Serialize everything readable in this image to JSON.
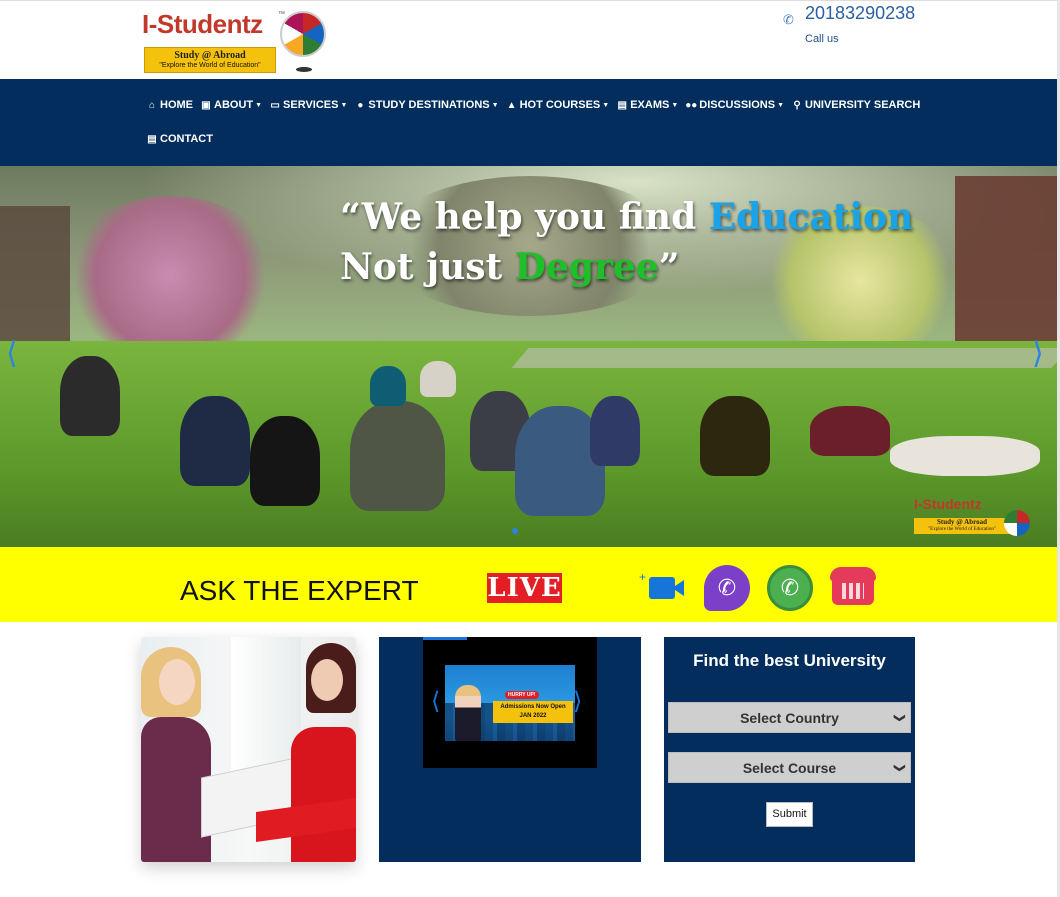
{
  "header": {
    "logo": {
      "brand": "I-Studentz",
      "trademark": "™",
      "tagline1": "Study @ Abroad",
      "tagline2": "\"Explore the World of Education\""
    },
    "phone": {
      "number": "20183290238",
      "caption": "Call us",
      "icon": "phone-icon"
    }
  },
  "nav": {
    "row1": [
      {
        "label": "HOME",
        "icon": "home-icon",
        "dropdown": false
      },
      {
        "label": "ABOUT",
        "icon": "info-icon",
        "dropdown": true
      },
      {
        "label": "SERVICES",
        "icon": "folder-icon",
        "dropdown": true
      },
      {
        "label": "STUDY DESTINATIONS",
        "icon": "globe-icon",
        "dropdown": true
      },
      {
        "label": "HOT COURSES",
        "icon": "graduation-cap-icon",
        "dropdown": true
      },
      {
        "label": "EXAMS",
        "icon": "clipboard-icon",
        "dropdown": true
      },
      {
        "label": "DISCUSSIONS",
        "icon": "users-icon",
        "dropdown": true
      },
      {
        "label": "UNIVERSITY SEARCH",
        "icon": "search-icon",
        "dropdown": false
      }
    ],
    "row2": [
      {
        "label": "CONTACT",
        "icon": "contact-card-icon",
        "dropdown": false
      }
    ]
  },
  "hero": {
    "line1_pre": "“We help you find ",
    "line1_highlight": "Education",
    "line2_pre": "Not just ",
    "line2_highlight": "Degree",
    "line2_post": "”",
    "watermark_brand": "I-Studentz",
    "watermark_tagline": "Study @ Abroad",
    "watermark_tagline2": "\"Explore the World of Education\""
  },
  "expert": {
    "label": "ASK THE EXPERT",
    "live": "LIVE",
    "icons": [
      "video-call-icon",
      "viber-icon",
      "whatsapp-icon",
      "telephone-icon"
    ]
  },
  "promo": {
    "hurry": "HURRY UP!",
    "announcement_l1": "Admissions Now Open",
    "announcement_l2": "JAN 2022"
  },
  "finder": {
    "title": "Find the best University",
    "country_select": "Select Country",
    "course_select": "Select Course",
    "submit": "Submit"
  },
  "colors": {
    "navy": "#022d5c",
    "yellow": "#ffff00",
    "education_blue": "#1aa3e8",
    "degree_green": "#1fbf2a",
    "live_red": "#e31e24"
  }
}
